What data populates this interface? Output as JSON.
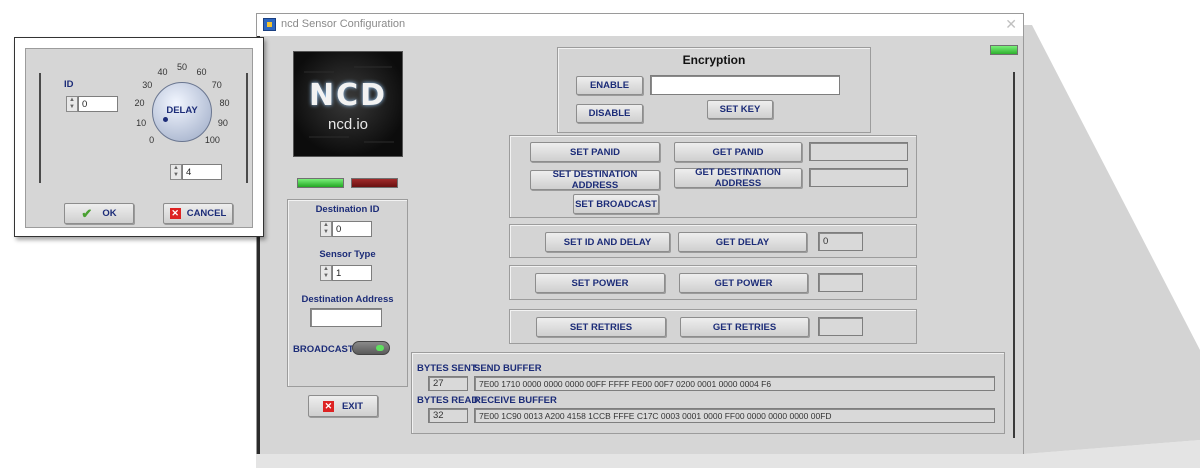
{
  "window": {
    "title": "ncd Sensor Configuration",
    "close_glyph": "✕"
  },
  "logo": {
    "brand": "NCD",
    "site": "ncd.io"
  },
  "indicators": {
    "top_right_color": "#3cc43c",
    "green_color": "#35c335",
    "red_color": "#8b1a1a"
  },
  "encryption": {
    "title": "Encryption",
    "enable_label": "ENABLE",
    "disable_label": "DISABLE",
    "set_key_label": "SET KEY",
    "key_value": ""
  },
  "left_panel": {
    "destination_id_label": "Destination ID",
    "destination_id_value": "0",
    "sensor_type_label": "Sensor Type",
    "sensor_type_value": "1",
    "destination_address_label": "Destination Address",
    "destination_address_value": "",
    "broadcast_label": "BROADCAST",
    "exit_label": "EXIT"
  },
  "panid": {
    "set_panid_label": "SET PANID",
    "get_panid_label": "GET PANID",
    "panid_value": "",
    "set_dest_label": "SET DESTINATION ADDRESS",
    "get_dest_label": "GET DESTINATION ADDRESS",
    "dest_value": "",
    "set_broadcast_label": "SET BROADCAST"
  },
  "id_delay": {
    "set_label": "SET ID AND DELAY",
    "get_label": "GET DELAY",
    "value": "0"
  },
  "power": {
    "set_label": "SET POWER",
    "get_label": "GET POWER",
    "value": ""
  },
  "retries": {
    "set_label": "SET RETRIES",
    "get_label": "GET RETRIES",
    "value": ""
  },
  "buffers": {
    "bytes_sent_label": "BYTES SENT",
    "bytes_sent_value": "27",
    "send_buffer_label": "SEND BUFFER",
    "send_buffer_value": "7E00 1710 0000 0000 0000 00FF FFFF FE00 00F7 0200 0001 0000 0004 F6",
    "bytes_read_label": "BYTES READ",
    "bytes_read_value": "32",
    "receive_buffer_label": "RECEIVE BUFFER",
    "receive_buffer_value": "7E00 1C90 0013 A200 4158 1CCB FFFE C17C 0003 0001 0000 FF00 0000 0000 0000 00FD"
  },
  "dialog": {
    "id_label": "ID",
    "id_value": "0",
    "delay_label": "DELAY",
    "delay_ticks": [
      "0",
      "10",
      "20",
      "30",
      "40",
      "50",
      "60",
      "70",
      "80",
      "90",
      "100"
    ],
    "delay_value": "4",
    "ok_label": "OK",
    "cancel_label": "CANCEL"
  }
}
